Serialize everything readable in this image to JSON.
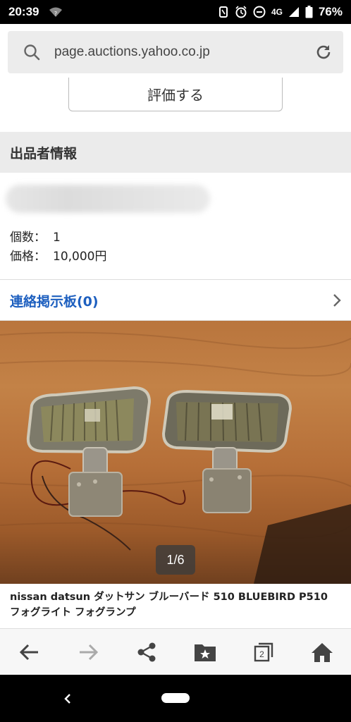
{
  "status_bar": {
    "time": "20:39",
    "network": "4G",
    "battery": "76%"
  },
  "url_bar": {
    "url": "page.auctions.yahoo.co.jp"
  },
  "rating": {
    "button_label": "評価する"
  },
  "seller_section": {
    "header": "出品者情報",
    "quantity_label": "個数：",
    "quantity_value": "1",
    "price_label": "価格：",
    "price_value": "10,000円"
  },
  "contact": {
    "label": "連絡掲示板(0)"
  },
  "gallery": {
    "counter": "1/6"
  },
  "item": {
    "title": "nissan datsun ダットサン ブルーバード 510 BLUEBIRD P510 フォグライト フォグランプ"
  },
  "toolbar": {
    "tabs_count": "2"
  },
  "colors": {
    "link": "#1d5fbf",
    "section_bg": "#ebebeb"
  }
}
